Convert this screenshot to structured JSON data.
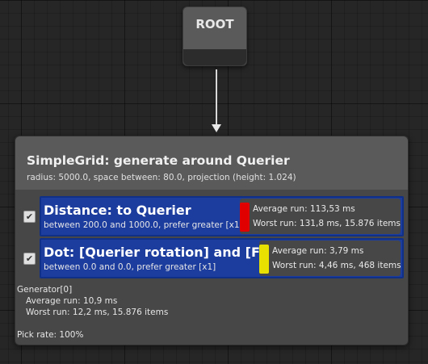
{
  "root": {
    "title": "ROOT"
  },
  "generator": {
    "title": "SimpleGrid: generate around Querier",
    "subtitle": "radius: 5000.0, space between: 80.0, projection (height: 1.024)",
    "tests": [
      {
        "title": "Distance: to Querier",
        "subtitle": "between 200.0 and 1000.0, prefer greater [x1]",
        "checked": true,
        "bar_color": "#e00000",
        "avg_run": "Average run: 113,53 ms",
        "worst_run": "Worst run: 131,8 ms, 15.876 items"
      },
      {
        "title": "Dot: [Querier rotation] and [Fr",
        "subtitle": "between 0.0 and 0.0, prefer greater [x1]",
        "checked": true,
        "bar_color": "#e8e000",
        "avg_run": "Average run: 3,79 ms",
        "worst_run": "Worst run: 4,46 ms, 468 items"
      }
    ],
    "footer": {
      "label": "Generator[0]",
      "avg_run": "Average run: 10,9 ms",
      "worst_run": "Worst run: 12,2 ms, 15.876 items",
      "pick_rate": "Pick rate: 100%"
    }
  }
}
